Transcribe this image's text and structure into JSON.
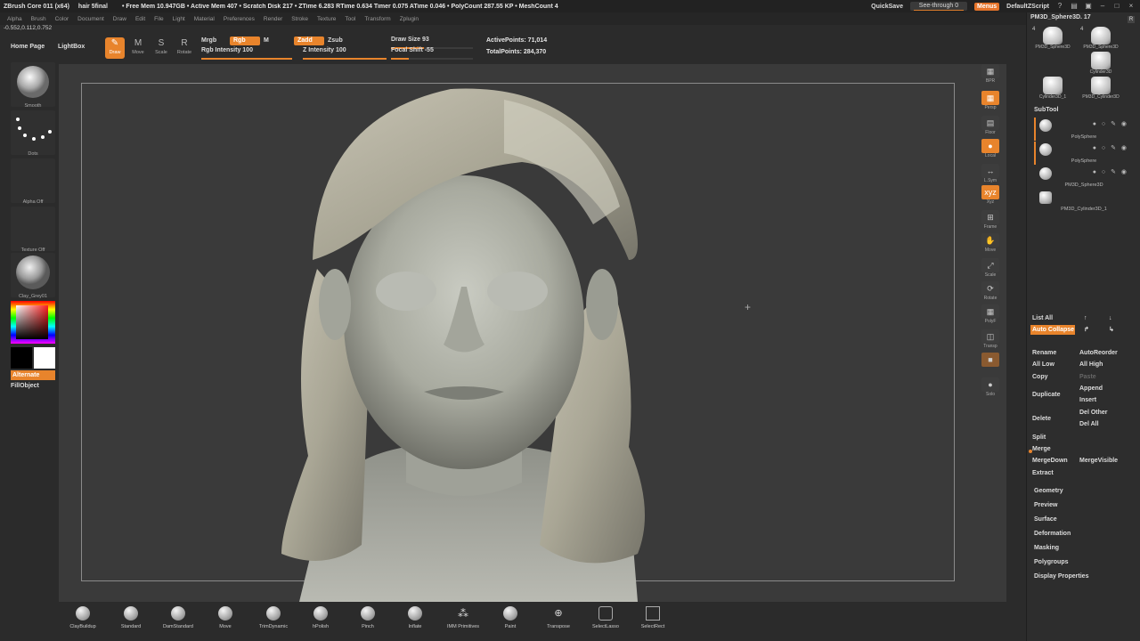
{
  "titlebar": {
    "app": "ZBrush Core 011 (x64)",
    "file": "hair 5final",
    "stats": "• Free Mem 10.947GB • Active Mem 407 • Scratch Disk 217 • ZTime 6.283 RTime 0.634 Timer 0.075 ATime 0.046 • PolyCount 287.55 KP • MeshCount 4",
    "quicksave": "QuickSave",
    "seethrough": "See-through 0",
    "menus": "Menus",
    "script": "DefaultZScript"
  },
  "menubar": [
    "Alpha",
    "Brush",
    "Color",
    "Document",
    "Draw",
    "Edit",
    "File",
    "Light",
    "Material",
    "Preferences",
    "Render",
    "Stroke",
    "Texture",
    "Tool",
    "Transform",
    "Zplugin"
  ],
  "coords": "-0.552,0.112,0.752",
  "shelf": {
    "home": "Home Page",
    "lightbox": "LightBox",
    "modes": [
      {
        "icon": "✎",
        "label": "Draw"
      },
      {
        "icon": "M",
        "label": "Move"
      },
      {
        "icon": "S",
        "label": "Scale"
      },
      {
        "icon": "R",
        "label": "Rotate"
      }
    ],
    "mrgb": "Mrgb",
    "rgb": "Rgb",
    "m": "M",
    "rgb_intensity": "Rgb Intensity 100",
    "zadd": "Zadd",
    "zsub": "Zsub",
    "z_intensity": "Z Intensity 100",
    "draw_size": "Draw Size 93",
    "focal_shift": "Focal Shift -55",
    "active_points": "ActivePoints: 71,014",
    "total_points": "TotalPoints: 284,370"
  },
  "leftshelf": {
    "brush": "Smooth",
    "stroke": "Dots",
    "alpha": "Alpha Off",
    "texture": "Texture Off",
    "material": "Clay_Grey01",
    "alternate": "Alternate",
    "fillobject": "FillObject"
  },
  "righttools": [
    {
      "icon": "▦",
      "label": "BPR"
    },
    {
      "icon": "▦",
      "label": "Persp"
    },
    {
      "icon": "▤",
      "label": "Floor"
    },
    {
      "icon": "●",
      "label": "Local"
    },
    {
      "icon": "↔",
      "label": "L.Sym"
    },
    {
      "icon": "xyz",
      "label": "Xyz"
    },
    {
      "icon": "⊞",
      "label": "Frame"
    },
    {
      "icon": "✋",
      "label": "Move"
    },
    {
      "icon": "⤢",
      "label": "Scale"
    },
    {
      "icon": "⟳",
      "label": "Rotate"
    },
    {
      "icon": "▦",
      "label": "PolyF"
    },
    {
      "icon": "◫",
      "label": "Transp"
    },
    {
      "icon": "■",
      "label": ""
    },
    {
      "icon": "●",
      "label": "Solo"
    }
  ],
  "brushes": [
    "ClayBuildup",
    "Standard",
    "DamStandard",
    "Move",
    "TrimDynamic",
    "hPolish",
    "Pinch",
    "Inflate",
    "IMM Primitives",
    "Paint",
    "Transpose",
    "SelectLasso",
    "SelectRect"
  ],
  "rpanel": {
    "header": "PM3D_Sphere3D. 17",
    "r": "R",
    "thumbs": [
      {
        "num": "4",
        "label": "PM3D_Sphere3D"
      },
      {
        "num": "4",
        "label": "PM3D_Sphere3D"
      },
      {
        "num": "",
        "label": "Cylinder3D"
      },
      {
        "num": "",
        "label": "Cylinder3D_1"
      },
      {
        "num": "",
        "label": "PM3D_Cylinder3D"
      }
    ],
    "subtool_title": "SubTool",
    "subtools": [
      "PolySphere",
      "PolySphere",
      "PM3D_Sphere3D",
      "PM3D_Cylinder3D_1"
    ],
    "list_all": "List All",
    "auto_collapse": "Auto Collapse",
    "rename": "Rename",
    "autoreorder": "AutoReorder",
    "all_low": "All Low",
    "all_high": "All High",
    "copy": "Copy",
    "paste": "Paste",
    "duplicate": "Duplicate",
    "append": "Append",
    "insert": "Insert",
    "delete": "Delete",
    "del_other": "Del Other",
    "del_all": "Del All",
    "split": "Split",
    "merge": "Merge",
    "mergedown": "MergeDown",
    "mergevisible": "MergeVisible",
    "extract": "Extract",
    "menus": [
      "Geometry",
      "Preview",
      "Surface",
      "Deformation",
      "Masking",
      "Polygroups",
      "Display Properties"
    ]
  },
  "colors": {
    "accent": "#e8842c",
    "canvas": "#3a3a3a",
    "panel": "#2d2d2d"
  }
}
